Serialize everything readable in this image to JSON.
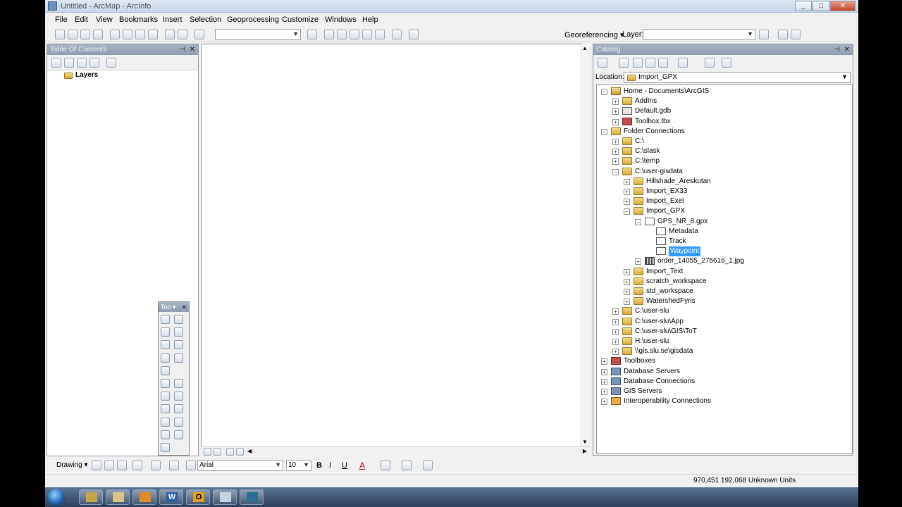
{
  "window": {
    "title": "Untitled - ArcMap - ArcInfo"
  },
  "menu": [
    "File",
    "Edit",
    "View",
    "Bookmarks",
    "Insert",
    "Selection",
    "Geoprocessing",
    "Customize",
    "Windows",
    "Help"
  ],
  "toolbar": {
    "georef_label": "Georeferencing ▾",
    "layer_label": "Layer:"
  },
  "toc": {
    "title": "Table Of Contents",
    "layers_label": "Layers"
  },
  "tools_window": {
    "title": "Too ▾"
  },
  "catalog": {
    "title": "Catalog",
    "location_label": "Location:",
    "location_value": "Import_GPX",
    "tree": [
      {
        "label": "Home - Documents\\ArcGIS",
        "icon": "home-folder-icon",
        "level": 0,
        "exp": "−"
      },
      {
        "label": "AddIns",
        "icon": "folder-icon",
        "level": 1,
        "exp": "+"
      },
      {
        "label": "Default.gdb",
        "icon": "geodatabase-icon",
        "level": 1,
        "exp": "+"
      },
      {
        "label": "Toolbox.tbx",
        "icon": "toolbox-icon",
        "level": 1,
        "exp": "+"
      },
      {
        "label": "Folder Connections",
        "icon": "folder-icon",
        "level": 0,
        "exp": "−"
      },
      {
        "label": "C:\\",
        "icon": "folder-icon",
        "level": 1,
        "exp": "+"
      },
      {
        "label": "C:\\slask",
        "icon": "folder-icon",
        "level": 1,
        "exp": "+"
      },
      {
        "label": "C:\\temp",
        "icon": "folder-icon",
        "level": 1,
        "exp": "+"
      },
      {
        "label": "C:\\user-gisdata",
        "icon": "folder-icon",
        "level": 1,
        "exp": "−"
      },
      {
        "label": "Hillshade_Areskutan",
        "icon": "folder-icon",
        "level": 2,
        "exp": "+"
      },
      {
        "label": "Import_EX33",
        "icon": "folder-icon",
        "level": 2,
        "exp": "+"
      },
      {
        "label": "Import_Exel",
        "icon": "folder-icon",
        "level": 2,
        "exp": "+"
      },
      {
        "label": "Import_GPX",
        "icon": "folder-icon",
        "level": 2,
        "exp": "−"
      },
      {
        "label": "GPS_NR_8.gpx",
        "icon": "gpx-file-icon",
        "level": 3,
        "exp": "−"
      },
      {
        "label": "Metadata",
        "icon": "metadata-icon",
        "level": 4,
        "exp": ""
      },
      {
        "label": "Track",
        "icon": "track-icon",
        "level": 4,
        "exp": ""
      },
      {
        "label": "Waypoint",
        "icon": "waypoint-icon",
        "level": 4,
        "exp": "",
        "selected": true
      },
      {
        "label": "order_14055_275616_1.jpg",
        "icon": "raster-icon",
        "level": 3,
        "exp": "+"
      },
      {
        "label": "Import_Text",
        "icon": "folder-icon",
        "level": 2,
        "exp": "+"
      },
      {
        "label": "scratch_workspace",
        "icon": "folder-icon",
        "level": 2,
        "exp": "+"
      },
      {
        "label": "std_workspace",
        "icon": "folder-icon",
        "level": 2,
        "exp": "+"
      },
      {
        "label": "WatershedFyris",
        "icon": "folder-icon",
        "level": 2,
        "exp": "+"
      },
      {
        "label": "C:\\user-slu",
        "icon": "folder-icon",
        "level": 1,
        "exp": "+"
      },
      {
        "label": "C:\\user-slu\\App",
        "icon": "folder-icon",
        "level": 1,
        "exp": "+"
      },
      {
        "label": "C:\\user-slu\\GIS\\ToT",
        "icon": "folder-icon",
        "level": 1,
        "exp": "+"
      },
      {
        "label": "H:\\user-slu",
        "icon": "folder-icon",
        "level": 1,
        "exp": "+"
      },
      {
        "label": "\\\\gis.slu.se\\gisdata",
        "icon": "folder-icon",
        "level": 1,
        "exp": "+"
      },
      {
        "label": "Toolboxes",
        "icon": "toolbox-icon",
        "level": 0,
        "exp": "+"
      },
      {
        "label": "Database Servers",
        "icon": "server-icon",
        "level": 0,
        "exp": "+"
      },
      {
        "label": "Database Connections",
        "icon": "database-icon",
        "level": 0,
        "exp": "+"
      },
      {
        "label": "GIS Servers",
        "icon": "server-icon",
        "level": 0,
        "exp": "+"
      },
      {
        "label": "Interoperability Connections",
        "icon": "interop-icon",
        "level": 0,
        "exp": "+"
      }
    ]
  },
  "drawing": {
    "label": "Drawing ▾",
    "font": "Arial",
    "size": "10"
  },
  "status": {
    "coords": "970,451  192,068 Unknown Units"
  }
}
